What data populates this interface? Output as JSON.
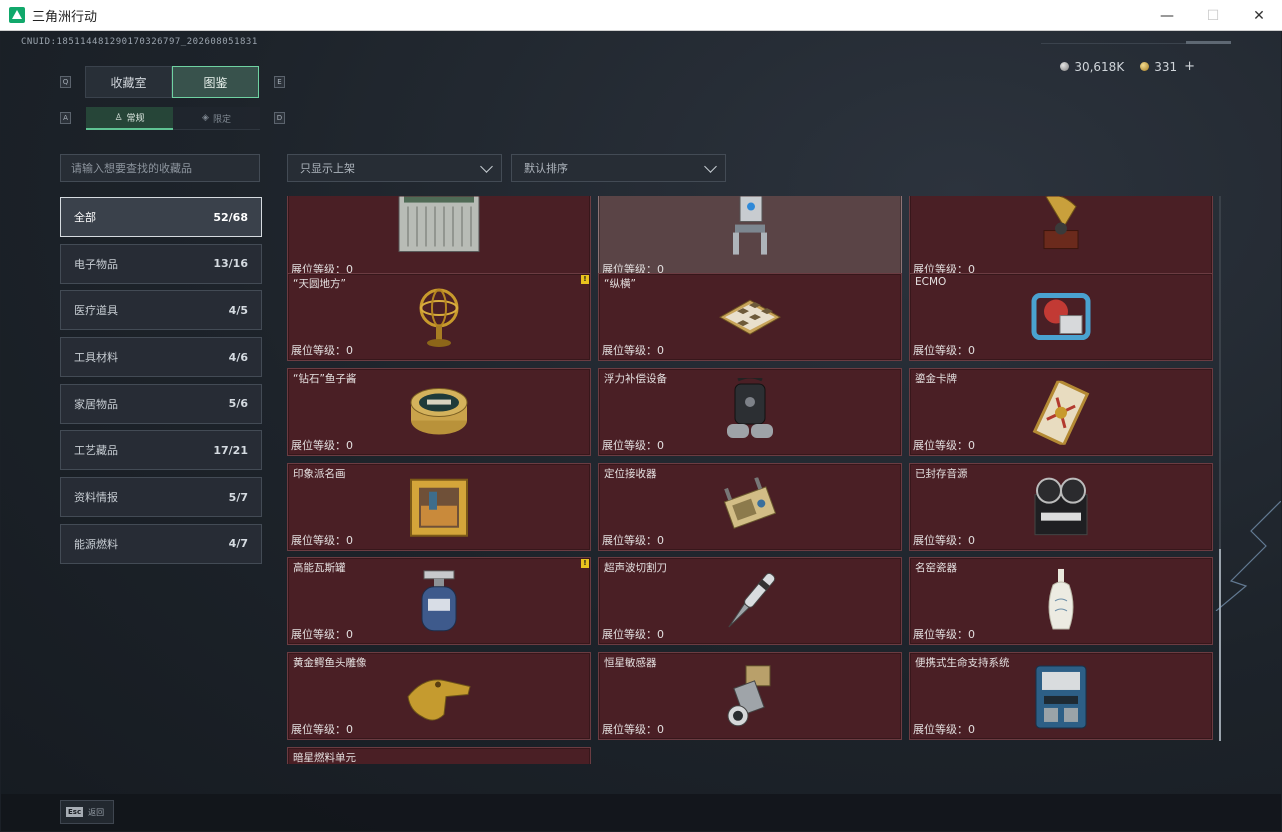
{
  "window": {
    "title": "三角洲行动",
    "minimize_icon": "—",
    "maximize_icon": "☐",
    "close_icon": "✕"
  },
  "uid": "CNUID:18511448129017032679​7_2026080518​31",
  "currency": [
    {
      "icon": "silver-coin-icon",
      "value": "30,618K"
    },
    {
      "icon": "gold-coin-icon",
      "value": "331"
    }
  ],
  "key_hints": {
    "q": "Q",
    "e": "E",
    "a": "A",
    "d": "D"
  },
  "main_tabs": [
    {
      "label": "收藏室",
      "active": false
    },
    {
      "label": "图鉴",
      "active": true
    }
  ],
  "sub_tabs": [
    {
      "label": "常规",
      "active": true
    },
    {
      "label": "限定",
      "active": false
    }
  ],
  "search": {
    "placeholder": "请输入想要查找的收藏品"
  },
  "filters": {
    "display": "只显示上架",
    "sort": "默认排序"
  },
  "categories": [
    {
      "label": "全部",
      "count": "52/68",
      "active": true
    },
    {
      "label": "电子物品",
      "count": "13/16"
    },
    {
      "label": "医疗道具",
      "count": "4/5"
    },
    {
      "label": "工具材料",
      "count": "4/6"
    },
    {
      "label": "家居物品",
      "count": "5/6"
    },
    {
      "label": "工艺藏品",
      "count": "17/21"
    },
    {
      "label": "资料情报",
      "count": "5/7"
    },
    {
      "label": "能源燃料",
      "count": "4/7"
    }
  ],
  "level_label": "展位等级：0",
  "items": [
    {
      "name": "",
      "icon": "server-cabinet-icon",
      "warn": false,
      "highlight": false
    },
    {
      "name": "",
      "icon": "robot-icon",
      "warn": false,
      "highlight": true
    },
    {
      "name": "",
      "icon": "gramophone-icon",
      "warn": false,
      "highlight": false
    },
    {
      "name": "“天圆地方”",
      "icon": "armillary-sphere-icon",
      "warn": true,
      "highlight": false
    },
    {
      "name": "“纵横”",
      "icon": "chessboard-icon",
      "warn": false,
      "highlight": false
    },
    {
      "name": "ECMO",
      "icon": "ecmo-machine-icon",
      "warn": false,
      "highlight": false
    },
    {
      "name": "“钻石”鱼子酱",
      "icon": "caviar-tin-icon",
      "warn": false,
      "highlight": false
    },
    {
      "name": "浮力补偿设备",
      "icon": "buoyancy-device-icon",
      "warn": false,
      "highlight": false
    },
    {
      "name": "鎏金卡牌",
      "icon": "gilded-card-icon",
      "warn": false,
      "highlight": false
    },
    {
      "name": "印象派名画",
      "icon": "framed-painting-icon",
      "warn": false,
      "highlight": false
    },
    {
      "name": "定位接收器",
      "icon": "gps-receiver-icon",
      "warn": false,
      "highlight": false
    },
    {
      "name": "已封存音源",
      "icon": "reel-recorder-icon",
      "warn": false,
      "highlight": false
    },
    {
      "name": "高能瓦斯罐",
      "icon": "gas-canister-icon",
      "warn": true,
      "highlight": false
    },
    {
      "name": "超声波切割刀",
      "icon": "ultrasonic-knife-icon",
      "warn": false,
      "highlight": false
    },
    {
      "name": "名窑瓷器",
      "icon": "porcelain-vase-icon",
      "warn": false,
      "highlight": false
    },
    {
      "name": "黄金鳄鱼头雕像",
      "icon": "gold-crocodile-icon",
      "warn": false,
      "highlight": false
    },
    {
      "name": "恒星敏感器",
      "icon": "star-sensor-icon",
      "warn": false,
      "highlight": false
    },
    {
      "name": "便携式生命支持系统",
      "icon": "life-support-icon",
      "warn": false,
      "highlight": false
    },
    {
      "name": "暗星燃料单元",
      "icon": "fuel-cell-icon",
      "warn": false,
      "highlight": false
    }
  ],
  "bottom": {
    "esc_key": "Esc",
    "back_label": "返回"
  },
  "colors": {
    "accent_green": "#5fc393",
    "card_bg": "#4a1f25",
    "card_highlight": "#5a4446",
    "warn_yellow": "#e8c21d"
  }
}
